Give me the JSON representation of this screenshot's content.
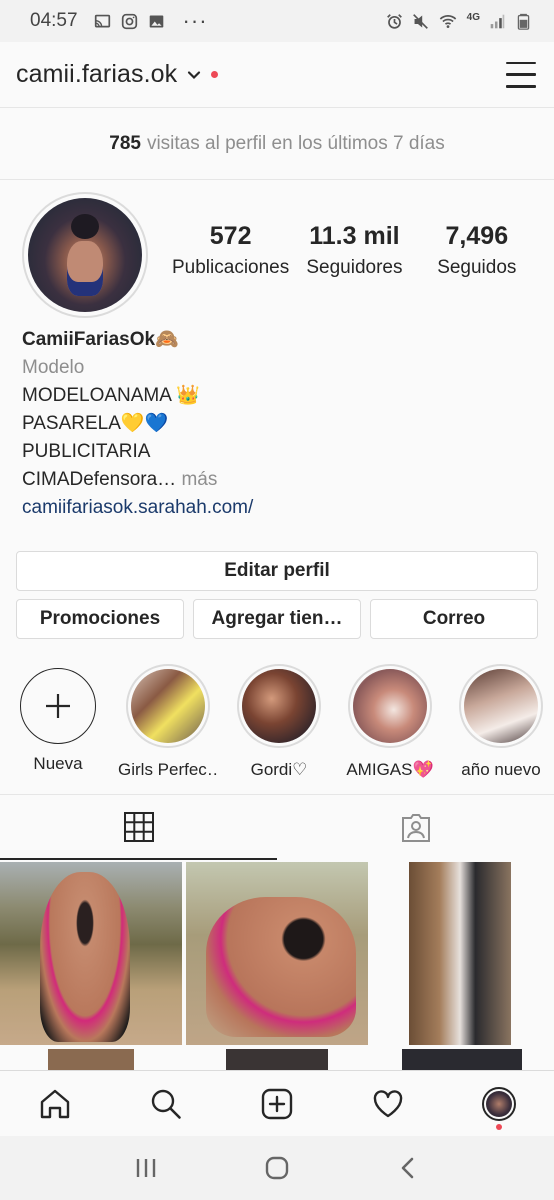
{
  "status_bar": {
    "time": "04:57",
    "dots": "···",
    "network": "4G"
  },
  "header": {
    "username": "camii.farias.ok"
  },
  "insights": {
    "count": "785",
    "text": "visitas al perfil en los últimos 7 días"
  },
  "stats": [
    {
      "value": "572",
      "label": "Publicaciones"
    },
    {
      "value": "11.3 mil",
      "label": "Seguidores"
    },
    {
      "value": "7,496",
      "label": "Seguidos"
    }
  ],
  "bio": {
    "name": "CamiiFariasOk🙈",
    "category": "Modelo",
    "lines": [
      "MODELOANAMA 👑",
      "PASARELA💛💙",
      "PUBLICITARIA"
    ],
    "truncated_line": "CIMADefensora…",
    "more": "más",
    "link": "camiifariasok.sarahah.com/"
  },
  "buttons": {
    "edit_profile": "Editar perfil",
    "promotions": "Promociones",
    "add_shop": "Agregar tien…",
    "email": "Correo"
  },
  "highlights": [
    {
      "label": "Nueva"
    },
    {
      "label": "Girls Perfec…"
    },
    {
      "label": "Gordi♡"
    },
    {
      "label": "AMIGAS💖"
    },
    {
      "label": "año nuevo"
    }
  ],
  "colors": {
    "accent_red": "#ed4956",
    "link_blue": "#1b3a6b",
    "secondary_text": "#8e8e8e"
  }
}
